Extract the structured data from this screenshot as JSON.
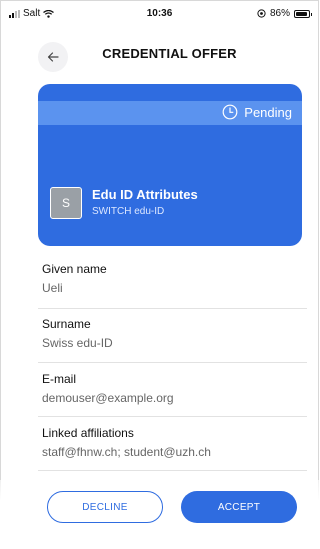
{
  "status_bar": {
    "carrier": "Salt",
    "time": "10:36",
    "battery": "86%"
  },
  "header": {
    "title": "CREDENTIAL OFFER"
  },
  "credential": {
    "status": "Pending",
    "avatar_letter": "S",
    "name": "Edu ID Attributes",
    "issuer": "SWITCH edu-ID"
  },
  "attributes": [
    {
      "label": "Given name",
      "value": "Ueli"
    },
    {
      "label": "Surname",
      "value": "Swiss edu-ID"
    },
    {
      "label": "E-mail",
      "value": "demouser@example.org"
    },
    {
      "label": "Linked affiliations",
      "value": "staff@fhnw.ch; student@uzh.ch"
    }
  ],
  "actions": {
    "decline": "DECLINE",
    "accept": "ACCEPT"
  },
  "colors": {
    "primary": "#2f6ce0",
    "pending_band": "#5b93ef"
  }
}
